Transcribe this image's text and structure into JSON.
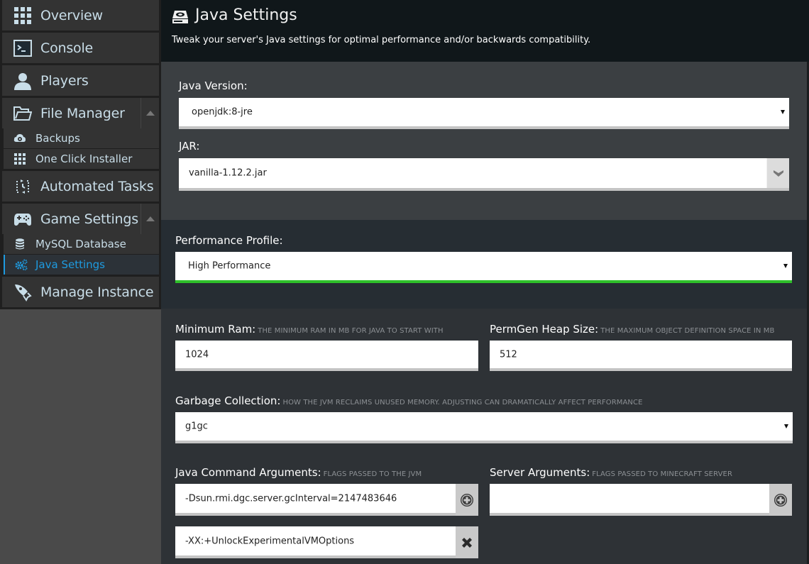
{
  "sidebar": {
    "items": [
      {
        "label": "Overview",
        "icon": "grid-icon"
      },
      {
        "label": "Console",
        "icon": "terminal-icon"
      },
      {
        "label": "Players",
        "icon": "user-icon"
      },
      {
        "label": "File Manager",
        "icon": "folder-icon",
        "expanded": true,
        "children": [
          {
            "label": "Backups",
            "icon": "backup-icon"
          },
          {
            "label": "One Click Installer",
            "icon": "grid-icon"
          }
        ]
      },
      {
        "label": "Automated Tasks",
        "icon": "refresh-clock-icon"
      },
      {
        "label": "Game Settings",
        "icon": "gamepad-icon",
        "expanded": true,
        "children": [
          {
            "label": "MySQL Database",
            "icon": "database-icon"
          },
          {
            "label": "Java Settings",
            "icon": "cogs-icon",
            "active": true
          }
        ]
      },
      {
        "label": "Manage Instance",
        "icon": "rocket-icon"
      }
    ]
  },
  "header": {
    "title": "Java Settings",
    "icon": "hard-drive-icon",
    "subtitle": "Tweak your server's Java settings for optimal performance and/or backwards compatibility."
  },
  "form": {
    "java_version": {
      "label": "Java Version:",
      "value": "openjdk:8-jre"
    },
    "jar": {
      "label": "JAR:",
      "value": "vanilla-1.12.2.jar"
    },
    "performance_profile": {
      "label": "Performance Profile:",
      "value": "High Performance"
    },
    "minimum_ram": {
      "label": "Minimum Ram:",
      "hint": "The minimum ram in MB for Java to start with",
      "value": "1024"
    },
    "permgen_heap": {
      "label": "PermGen Heap Size:",
      "hint": "The maximum object definition space in MB",
      "value": "512"
    },
    "garbage_collection": {
      "label": "Garbage Collection:",
      "hint": "How the JVM reclaims unused memory. Adjusting can dramatically affect performance",
      "value": "g1gc"
    },
    "java_args": {
      "label": "Java Command Arguments:",
      "hint": "Flags passed to the JVM",
      "values": [
        "-Dsun.rmi.dgc.server.gcInterval=2147483646",
        "-XX:+UnlockExperimentalVMOptions"
      ]
    },
    "server_args": {
      "label": "Server Arguments:",
      "hint": "Flags passed to Minecraft server",
      "values": [
        ""
      ]
    }
  },
  "colors": {
    "accent": "#1e9be0",
    "success": "#2ec02a",
    "sidebar_text": "#c8dde8"
  }
}
